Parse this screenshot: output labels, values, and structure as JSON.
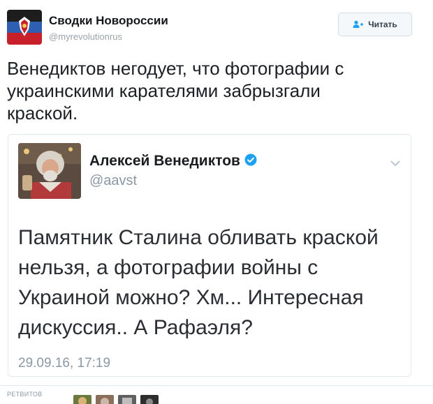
{
  "author": {
    "name": "Сводки Новороссии",
    "handle": "@myrevolutionrus"
  },
  "follow_button": {
    "label": "Читать",
    "icon": "follow-user-icon"
  },
  "tweet": {
    "text": "Венедиктов негодует, что фотографии с украинскими карателями забрызгали краской."
  },
  "quoted": {
    "name": "Алексей Венедиктов",
    "verified_icon": "verified-badge-icon",
    "handle": "@aavst",
    "text": "Памятник Сталина обливать краской нельзя, а фотографии войны с Украиной можно? Хм... Интересная дискуссия.. А Рафаэля?",
    "date": "29.09.16, 17:19",
    "menu_icon": "chevron-down-icon"
  },
  "footer": {
    "retweets_label": "РЕТВИТОВ"
  },
  "colors": {
    "verified": "#1da1f2",
    "handle": "#8b98a4",
    "border": "#e1e8ed"
  }
}
